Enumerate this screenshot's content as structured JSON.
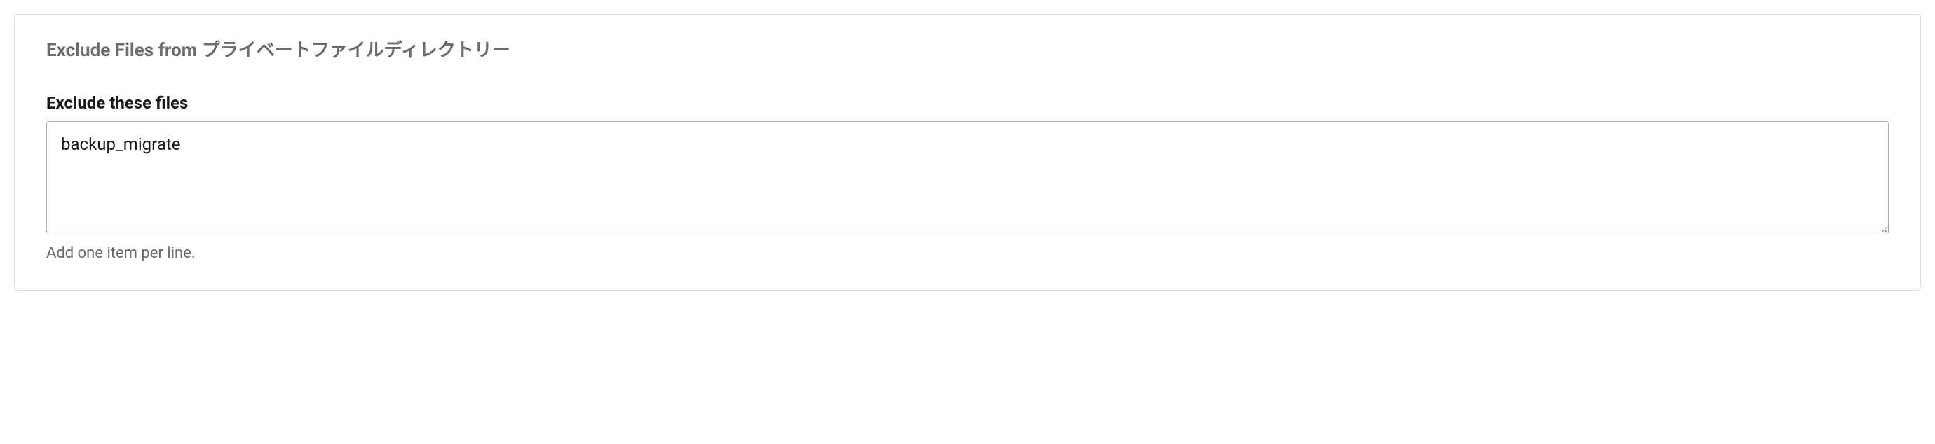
{
  "panel": {
    "title": "Exclude Files from プライベートファイルディレクトリー",
    "field": {
      "label": "Exclude these files",
      "value": "backup_migrate",
      "help": "Add one item per line."
    }
  }
}
